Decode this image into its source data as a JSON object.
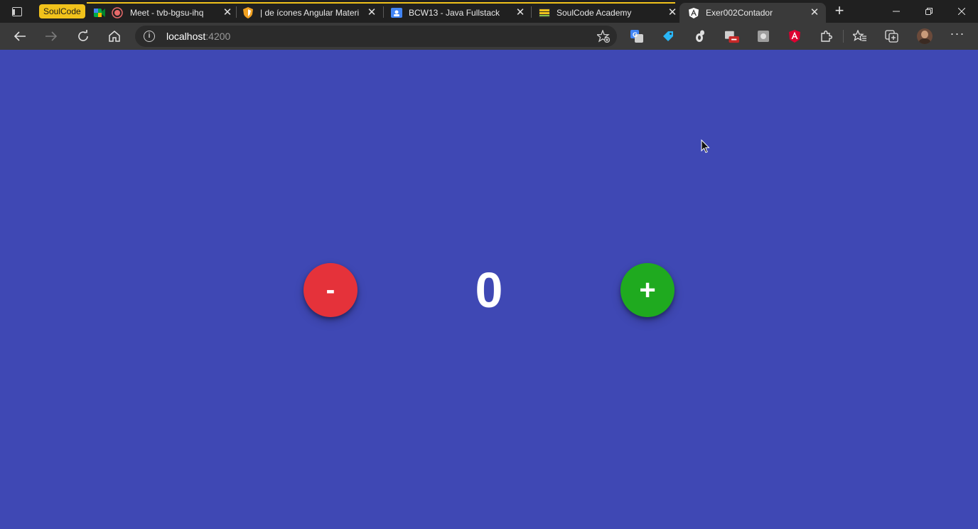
{
  "browser": {
    "tab_group": {
      "label": "SoulCode",
      "color": "#f1c21b"
    },
    "tabs": [
      {
        "title": "Meet - tvb-bgsu-ihq",
        "icon": "google-meet-icon",
        "recording": true
      },
      {
        "title": "| de ícones Angular Materi",
        "icon": "shield-icon"
      },
      {
        "title": "BCW13 - Java Fullstack",
        "icon": "google-classroom-icon"
      },
      {
        "title": "SoulCode Academy",
        "icon": "soulcode-icon"
      },
      {
        "title": "Exer002Contador",
        "icon": "angular-icon",
        "active": true
      }
    ],
    "address": {
      "host": "localhost",
      "port": ":4200"
    },
    "extensions": [
      "translate-icon",
      "tag-icon",
      "gnome-icon",
      "extension-badge-icon",
      "square-extension-icon",
      "angular-devtools-icon",
      "puzzle-icon"
    ]
  },
  "app": {
    "minus_label": "-",
    "plus_label": "+",
    "counter_value": "0",
    "colors": {
      "background": "#3f48b4",
      "minus": "#e5323a",
      "plus": "#1faa1f"
    }
  }
}
